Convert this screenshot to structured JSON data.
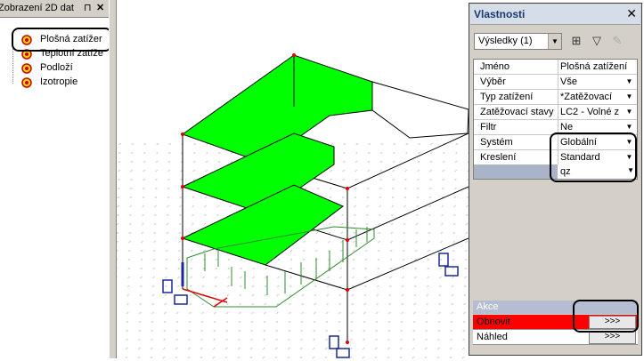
{
  "left_panel": {
    "title": "Zobrazení 2D dat",
    "items": [
      {
        "label": "Plošná zatížer"
      },
      {
        "label": "Teplotní zatíže"
      },
      {
        "label": "Podloží"
      },
      {
        "label": "Izotropie"
      }
    ]
  },
  "properties": {
    "title": "Vlastnosti",
    "view_select": "Výsledky (1)",
    "rows": [
      {
        "key": "Jméno",
        "value": "Plošná zatížení"
      },
      {
        "key": "Výběr",
        "value": "Vše"
      },
      {
        "key": "Typ zatížení",
        "value": "*Zatěžovací"
      },
      {
        "key": "Zatěžovací stavy",
        "value": "LC2 - Volné z"
      },
      {
        "key": "Filtr",
        "value": "Ne"
      },
      {
        "key": "Systém",
        "value": "Globální"
      },
      {
        "key": "Kreslení",
        "value": "Standard"
      },
      {
        "key": "Hodnoty",
        "value": "qz"
      }
    ],
    "actions_header": "Akce",
    "actions": [
      {
        "label": "Obnovit",
        "button": ">>>"
      },
      {
        "label": "Náhled",
        "button": ">>>"
      }
    ]
  },
  "colors": {
    "slab_fill": "#00ff00",
    "refresh_row": "#ff0000",
    "panel_bg": "#d4d0c8",
    "load_arrows": "#2e8b2e",
    "supports": "#1a2a9a"
  }
}
